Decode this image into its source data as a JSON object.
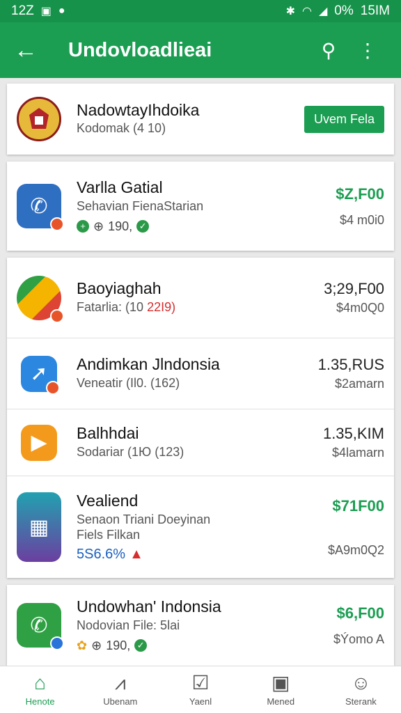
{
  "status": {
    "time": "12Z",
    "battery": "0%",
    "clock": "15IM"
  },
  "appbar": {
    "title": "Undovloadlieai"
  },
  "featured": {
    "name": "NadowtayIhdoika",
    "sub": "Kodomak (4 10)",
    "button": "Uvem Fela"
  },
  "apps": [
    {
      "name": "Varlla Gatial",
      "sub": "Sehavian FienaStarian",
      "meta": "190,",
      "price": "$Z,F00",
      "size": "$4 m0i0",
      "color": "#2f6fc2"
    },
    {
      "name": "Baoyiaghah",
      "sub": "Fatarlia: (10",
      "sub_red": "22I9)",
      "price": "3;29,F00",
      "size": "$4m0Q0",
      "color": "#dd4433"
    },
    {
      "name": "Andimkan Jlndonsia",
      "sub": "Veneatir (Il0. (162)",
      "price": "1.35,RUS",
      "size": "$2amarn",
      "color": "#2b87e0"
    },
    {
      "name": "Balhhdai",
      "sub": "Sodariar (1Ю (123)",
      "price": "1.35,KIM",
      "size": "$4lamarn",
      "color": "#f39a1c"
    },
    {
      "name": "Vealiend",
      "sub": "Senaon Triani Doeyinan",
      "sub2": "Fiels Filkan",
      "meta": "5S6.6%",
      "price": "$71F00",
      "size": "$A9m0Q2",
      "color": "#22a1b0"
    },
    {
      "name": "Undowhan' Indonsia",
      "sub": "Nodovian File: 5lai",
      "meta": "190,",
      "price": "$6,F00",
      "size": "$Ýomo A",
      "color": "#2fa044"
    }
  ],
  "nav": [
    {
      "label": "Henote",
      "icon": "home-icon"
    },
    {
      "label": "Ubenam",
      "icon": "chart-icon"
    },
    {
      "label": "Yaenl",
      "icon": "checkbox-icon"
    },
    {
      "label": "Mened",
      "icon": "message-icon"
    },
    {
      "label": "Sterank",
      "icon": "person-icon"
    }
  ]
}
